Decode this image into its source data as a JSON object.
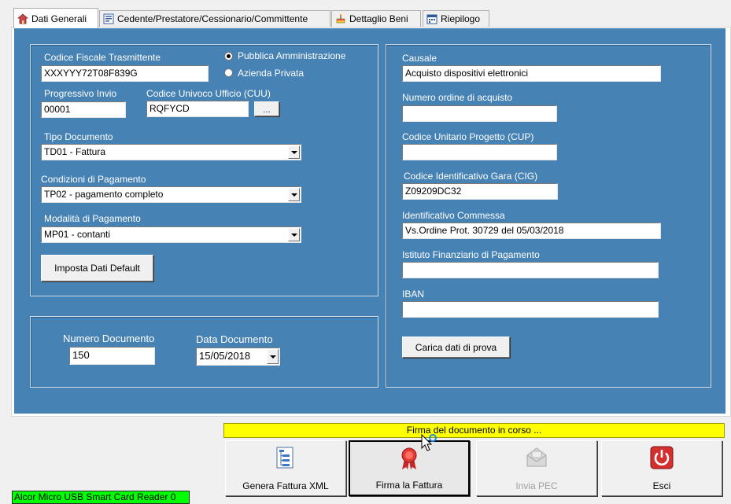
{
  "tabs": [
    {
      "label": "Dati Generali",
      "icon": "house-icon",
      "active": true
    },
    {
      "label": "Cedente/Prestatore/Cessionario/Committente",
      "icon": "form-icon",
      "active": false
    },
    {
      "label": "Dettaglio Beni",
      "icon": "cake-icon",
      "active": false
    },
    {
      "label": "Riepilogo",
      "icon": "calendar-icon",
      "active": false
    }
  ],
  "left": {
    "codice_fiscale_label": "Codice Fiscale Trasmittente",
    "codice_fiscale_value": "XXXYYY72T08F839G",
    "radio_pa_label": "Pubblica Amministrazione",
    "radio_az_label": "Azienda Privata",
    "progressivo_label": "Progressivo Invio",
    "progressivo_value": "00001",
    "cuu_label": "Codice Univoco Ufficio (CUU)",
    "cuu_value": "RQFYCD",
    "cuu_button": "...",
    "tipo_doc_label": "Tipo Documento",
    "tipo_doc_value": "TD01 - Fattura",
    "condizioni_label": "Condizioni di Pagamento",
    "condizioni_value": "TP02 - pagamento completo",
    "modalita_label": "Modalità di Pagamento",
    "modalita_value": "MP01 - contanti",
    "default_button": "Imposta Dati Default"
  },
  "doc": {
    "numero_label": "Numero Documento",
    "numero_value": "150",
    "data_label": "Data Documento",
    "data_value": "15/05/2018"
  },
  "right": {
    "causale_label": "Causale",
    "causale_value": "Acquisto dispositivi elettronici",
    "ordine_label": "Numero ordine di acquisto",
    "ordine_value": "",
    "cup_label": "Codice Unitario Progetto (CUP)",
    "cup_value": "",
    "cig_label": "Codice Identificativo Gara (CIG)",
    "cig_value": "Z09209DC32",
    "commessa_label": "Identificativo Commessa",
    "commessa_value": "Vs.Ordine Prot. 30729 del 05/03/2018",
    "istituto_label": "Istituto Finanziario di Pagamento",
    "istituto_value": "",
    "iban_label": "IBAN",
    "iban_value": "",
    "prova_button": "Carica dati di prova"
  },
  "status_text": "Firma del documento in corso ...",
  "actions": [
    {
      "label": "Genera Fattura XML",
      "icon": "xml-tree-icon",
      "enabled": true
    },
    {
      "label": "Firma la Fattura",
      "icon": "seal-ribbon-icon",
      "enabled": true
    },
    {
      "label": "Invia PEC",
      "icon": "envelope-icon",
      "enabled": false
    },
    {
      "label": "Esci",
      "icon": "power-icon",
      "enabled": true
    }
  ],
  "reader_status": "Alcor Micro USB Smart Card Reader 0",
  "colors": {
    "panel": "#4682b4",
    "status_bar": "#ffff00",
    "reader_badge": "#00ff00"
  }
}
